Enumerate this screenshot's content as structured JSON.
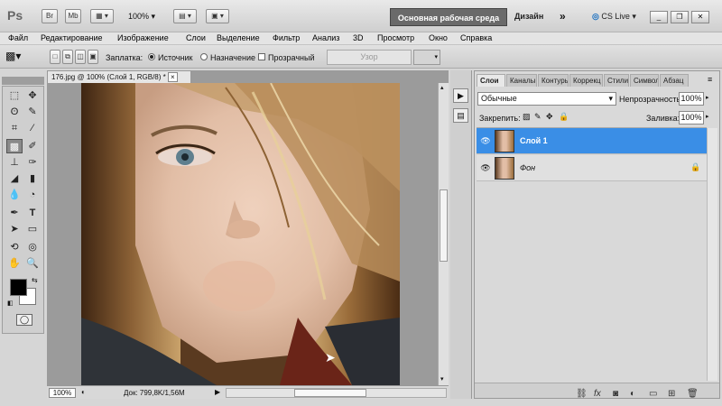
{
  "app": {
    "logo": "Ps",
    "br": "Br",
    "mb": "Mb",
    "zoom": "100%"
  },
  "workspace": {
    "primary": "Основная рабочая среда",
    "secondary": "Дизайн",
    "more": "»",
    "cslive": "CS Live"
  },
  "menu": [
    "Файл",
    "Редактирование",
    "Изображение",
    "Слои",
    "Выделение",
    "Фильтр",
    "Анализ",
    "3D",
    "Просмотр",
    "Окно",
    "Справка"
  ],
  "options": {
    "patch_label": "Заплатка:",
    "source": "Источник",
    "destination": "Назначение",
    "transparent": "Прозрачный",
    "pattern": "Узор"
  },
  "document": {
    "tab": "176.jpg @ 100% (Слой 1, RGB/8) *",
    "zoom": "100%",
    "doc_info": "Док: 799,8K/1,56M"
  },
  "panel": {
    "tabs": [
      "Слои",
      "Каналы",
      "Контуры",
      "Коррекц",
      "Стили",
      "Символ",
      "Абзац"
    ],
    "blend_mode": "Обычные",
    "opacity_label": "Непрозрачность:",
    "opacity": "100%",
    "lock_label": "Закрепить:",
    "fill_label": "Заливка:",
    "fill": "100%",
    "layers": [
      {
        "name": "Слой 1",
        "selected": true
      },
      {
        "name": "Фон",
        "selected": false,
        "locked": true
      }
    ]
  },
  "colors": {
    "foreground": "#000000",
    "background": "#ffffff",
    "selection": "#3a8ee6"
  }
}
